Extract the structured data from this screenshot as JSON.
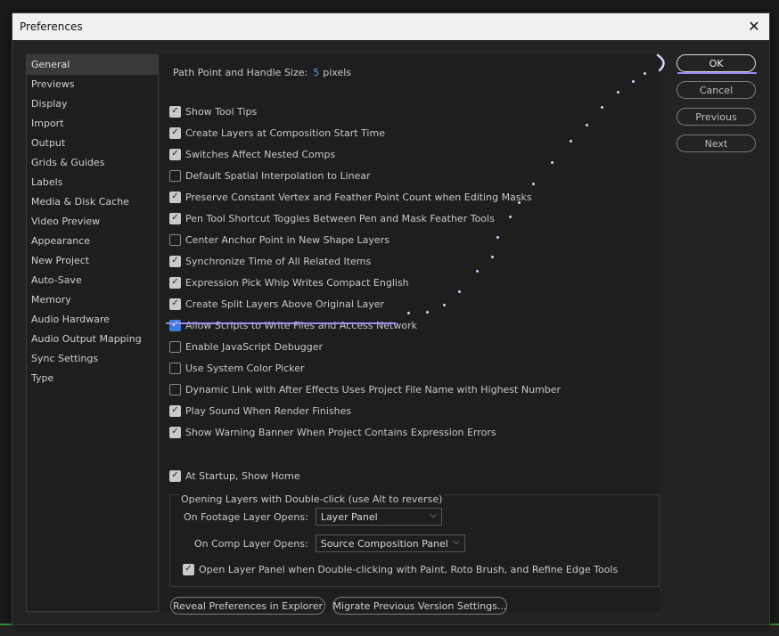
{
  "dialog": {
    "title": "Preferences",
    "close_glyph": "✕"
  },
  "sidebar": {
    "items": [
      {
        "label": "General",
        "active": true
      },
      {
        "label": "Previews"
      },
      {
        "label": "Display"
      },
      {
        "label": "Import"
      },
      {
        "label": "Output"
      },
      {
        "label": "Grids & Guides"
      },
      {
        "label": "Labels"
      },
      {
        "label": "Media & Disk Cache"
      },
      {
        "label": "Video Preview"
      },
      {
        "label": "Appearance"
      },
      {
        "label": "New Project"
      },
      {
        "label": "Auto-Save"
      },
      {
        "label": "Memory"
      },
      {
        "label": "Audio Hardware"
      },
      {
        "label": "Audio Output Mapping"
      },
      {
        "label": "Sync Settings"
      },
      {
        "label": "Type"
      }
    ]
  },
  "general": {
    "path_point_label": "Path Point and Handle Size:",
    "path_point_value": "5",
    "path_point_unit": "pixels",
    "options": [
      {
        "label": "Show Tool Tips",
        "checked": true
      },
      {
        "label": "Create Layers at Composition Start Time",
        "checked": true
      },
      {
        "label": "Switches Affect Nested Comps",
        "checked": true
      },
      {
        "label": "Default Spatial Interpolation to Linear",
        "checked": false
      },
      {
        "label": "Preserve Constant Vertex and Feather Point Count when Editing Masks",
        "checked": true
      },
      {
        "label": "Pen Tool Shortcut Toggles Between Pen and Mask Feather Tools",
        "checked": true
      },
      {
        "label": "Center Anchor Point in New Shape Layers",
        "checked": false
      },
      {
        "label": "Synchronize Time of All Related Items",
        "checked": true
      },
      {
        "label": "Expression Pick Whip Writes Compact English",
        "checked": true
      },
      {
        "label": "Create Split Layers Above Original Layer",
        "checked": true
      },
      {
        "label": "Allow Scripts to Write Files and Access Network",
        "checked": true,
        "highlight": true
      },
      {
        "label": "Enable JavaScript Debugger",
        "checked": false
      },
      {
        "label": "Use System Color Picker",
        "checked": false
      },
      {
        "label": "Dynamic Link with After Effects Uses Project File Name with Highest Number",
        "checked": false
      },
      {
        "label": "Play Sound When Render Finishes",
        "checked": true
      },
      {
        "label": "Show Warning Banner When Project Contains Expression Errors",
        "checked": true
      }
    ],
    "startup_home_label": "At Startup, Show Home",
    "startup_home_checked": true,
    "group_title": "Opening Layers with Double-click (use Alt to reverse)",
    "footage_label": "On Footage Layer Opens:",
    "footage_value": "Layer Panel",
    "comp_label": "On Comp Layer Opens:",
    "comp_value": "Source Composition Panel",
    "open_layer_panel_label": "Open Layer Panel when Double-clicking with Paint, Roto Brush, and Refine Edge Tools",
    "open_layer_panel_checked": true,
    "reveal_label": "Reveal Preferences in Explorer",
    "migrate_label": "Migrate Previous Version Settings..."
  },
  "buttons": {
    "ok": "OK",
    "cancel": "Cancel",
    "previous": "Previous",
    "next": "Next"
  },
  "icons": {
    "checkmark": "✓",
    "chevron": "⌵"
  },
  "colors": {
    "accent_blue": "#3b7de0",
    "annotation_purple": "#9b8cf0"
  }
}
